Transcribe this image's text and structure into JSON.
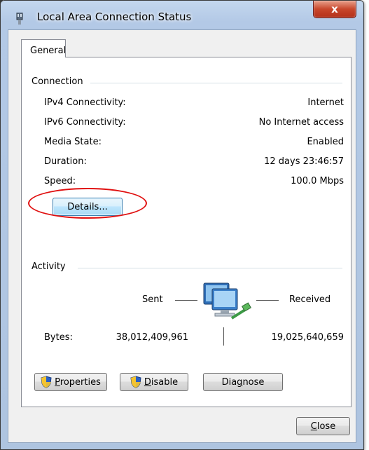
{
  "window": {
    "title": "Local Area Connection Status",
    "close_glyph": "x"
  },
  "tabs": [
    {
      "label": "General"
    }
  ],
  "connection": {
    "heading": "Connection",
    "rows": [
      {
        "label": "IPv4 Connectivity:",
        "value": "Internet"
      },
      {
        "label": "IPv6 Connectivity:",
        "value": "No Internet access"
      },
      {
        "label": "Media State:",
        "value": "Enabled"
      },
      {
        "label": "Duration:",
        "value": "12 days 23:46:57"
      },
      {
        "label": "Speed:",
        "value": "100.0 Mbps"
      }
    ],
    "details_button": "Details..."
  },
  "activity": {
    "heading": "Activity",
    "sent_label": "Sent",
    "received_label": "Received",
    "bytes_label": "Bytes:",
    "bytes_sent": "38,012,409,961",
    "bytes_received": "19,025,640,659",
    "icon": "network-computers-icon"
  },
  "buttons": {
    "properties_prefix": "",
    "properties_mnemonic": "P",
    "properties_rest": "roperties",
    "disable_mnemonic": "D",
    "disable_rest": "isable",
    "diagnose_pre": "Dia",
    "diagnose_mnemonic": "g",
    "diagnose_rest": "nose",
    "close_mnemonic": "C",
    "close_rest": "lose"
  },
  "colors": {
    "annotation_circle": "#e01010",
    "shield_blue": "#2b61c4",
    "shield_yellow": "#f4c430"
  }
}
